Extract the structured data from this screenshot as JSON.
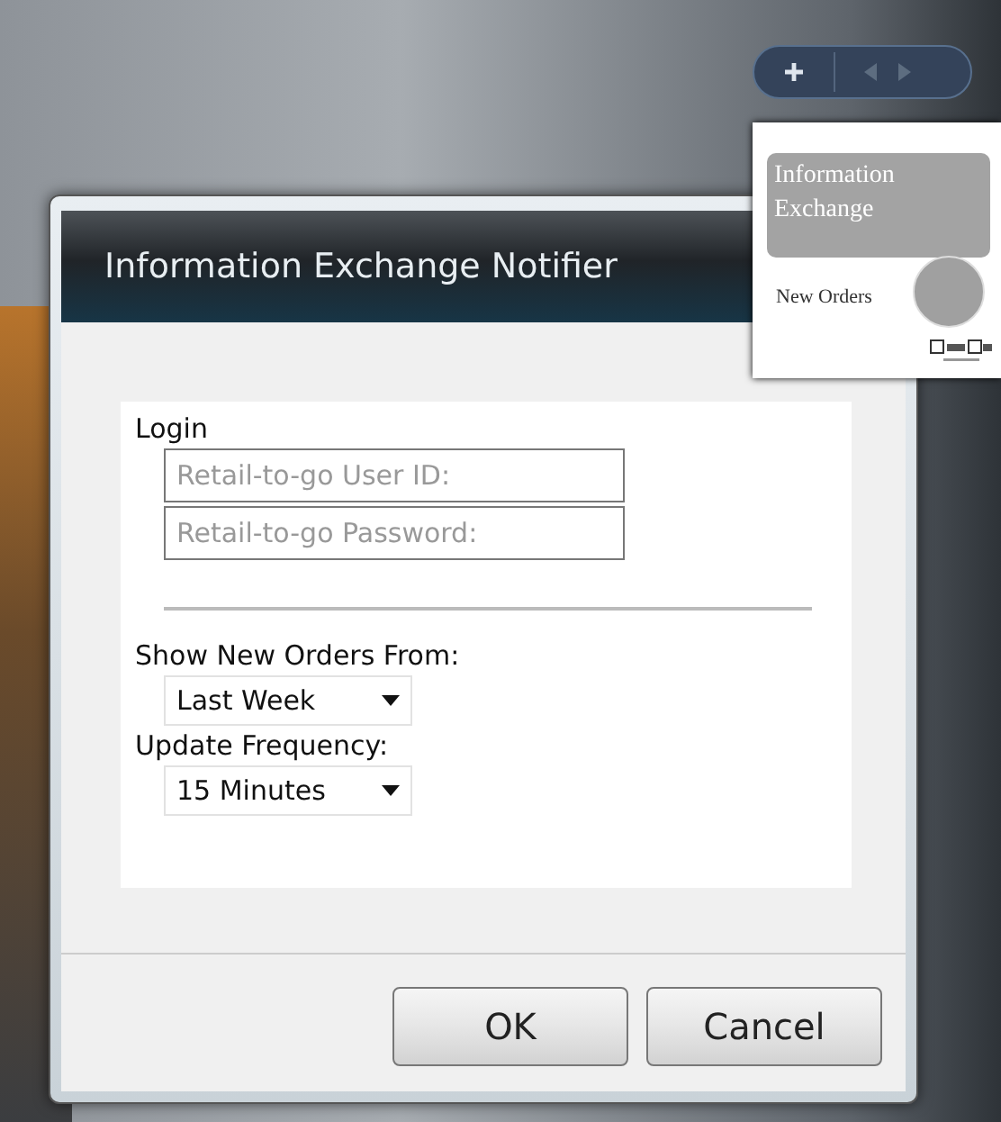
{
  "gadget": {
    "title": "Information Exchange",
    "caption": "New Orders"
  },
  "dialog": {
    "title": "Information Exchange Notifier",
    "login": {
      "label": "Login",
      "fields": [
        {
          "placeholder": "Retail-to-go User ID:"
        },
        {
          "placeholder": "Retail-to-go Password:"
        }
      ]
    },
    "dropdowns": [
      {
        "label": "Show New Orders From:",
        "value": "Last Week"
      },
      {
        "label": "Update Frequency:",
        "value": "15 Minutes"
      }
    ],
    "buttons": [
      "OK",
      "Cancel"
    ]
  }
}
